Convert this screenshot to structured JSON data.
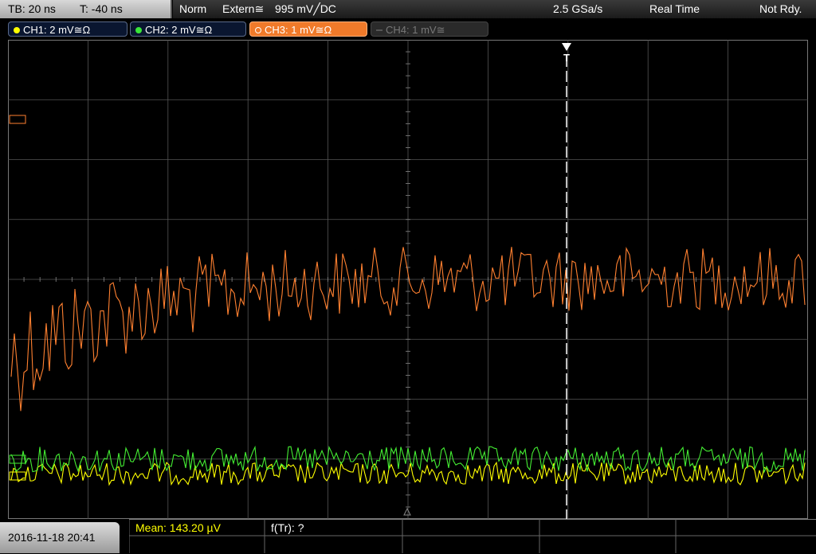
{
  "timebase": {
    "tb": "TB: 20 ns",
    "t": "T: -40 ns"
  },
  "trigger": {
    "mode": "Norm",
    "source": "Extern",
    "coupling_symbol": "≅",
    "level": "995 mV",
    "slope": "╱",
    "coupling": "DC"
  },
  "acquisition": {
    "sample_rate": "2.5 GSa/s",
    "mode": "Real Time",
    "state": "Not Rdy."
  },
  "channels": [
    {
      "label": "CH1: 2 mV≅Ω",
      "color": "#ffff00",
      "active": false
    },
    {
      "label": "CH2: 2 mV≅Ω",
      "color": "#39e639",
      "active": false
    },
    {
      "label": "CH3: 1 mV≅Ω",
      "color": "#ff8a3a",
      "active": true
    },
    {
      "label": "CH4: 1 mV≅",
      "color": "#555555",
      "active": false
    }
  ],
  "trigger_marker": "T",
  "measurements": {
    "mean": "Mean: 143.20 µV",
    "ftr": "f(Tr): ?"
  },
  "datetime": "2016-11-18 20:41",
  "colors": {
    "ch1": "#ffff00",
    "ch2": "#44ee33",
    "ch3": "#ff8030",
    "grid": "#555555"
  }
}
